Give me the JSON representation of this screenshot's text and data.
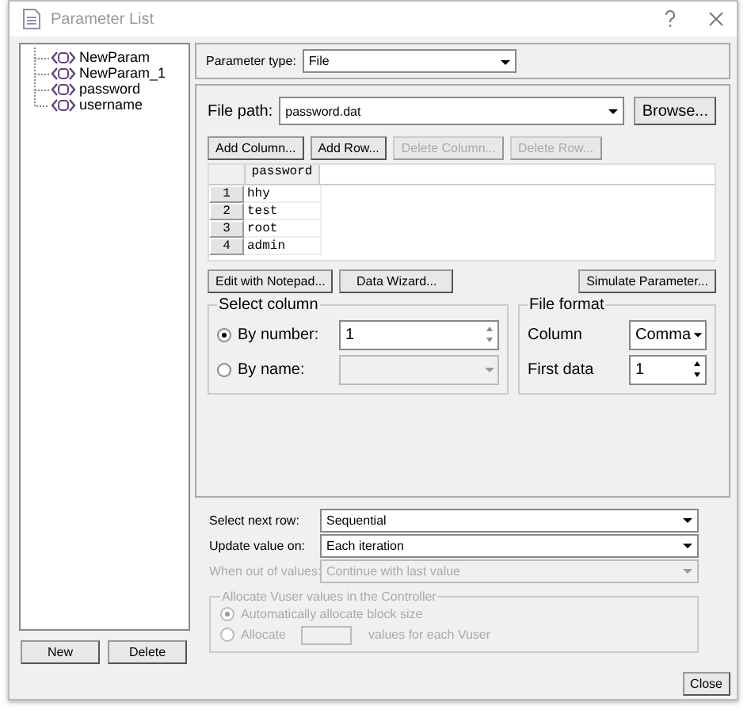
{
  "window": {
    "title": "Parameter List"
  },
  "parameters": [
    {
      "label": "NewParam",
      "selected": false
    },
    {
      "label": "NewParam_1",
      "selected": false
    },
    {
      "label": "password",
      "selected": false
    },
    {
      "label": "username",
      "selected": false
    }
  ],
  "parameter_type": {
    "label": "Parameter type:",
    "value": "File"
  },
  "file_path": {
    "label": "File path:",
    "value": "password.dat",
    "browse": "Browse..."
  },
  "grid_buttons": [
    {
      "label": "Add Column...",
      "disabled": false
    },
    {
      "label": "Add Row...",
      "disabled": false
    },
    {
      "label": "Delete Column...",
      "disabled": true
    },
    {
      "label": "Delete Row...",
      "disabled": true
    }
  ],
  "table": {
    "columns": [
      "password"
    ],
    "rows": [
      {
        "number": "1",
        "cells": [
          "hhy"
        ]
      },
      {
        "number": "2",
        "cells": [
          "test"
        ]
      },
      {
        "number": "3",
        "cells": [
          "root"
        ]
      },
      {
        "number": "4",
        "cells": [
          "admin"
        ]
      }
    ]
  },
  "action_buttons": [
    "Edit with Notepad...",
    "Data Wizard...",
    "Simulate Parameter..."
  ],
  "select_column": {
    "title": "Select column",
    "options": [
      {
        "label": "By number:",
        "selected": true,
        "kind": "spin",
        "value": "1",
        "disabled": false
      },
      {
        "label": "By name:",
        "selected": false,
        "kind": "dropdown",
        "disabled": true
      }
    ]
  },
  "file_format": {
    "title": "File format",
    "column": {
      "label": "Column",
      "value": "Comma"
    },
    "first_data": {
      "label": "First data",
      "value": "1"
    }
  },
  "settings": [
    {
      "label": "Select next row:",
      "value": "Sequential",
      "disabled": false
    },
    {
      "label": "Update value on:",
      "value": "Each iteration",
      "disabled": false
    },
    {
      "label": "When out of values:",
      "value": "Continue with last value",
      "disabled": true
    }
  ],
  "allocate": {
    "title": "Allocate Vuser values in the Controller",
    "disabled": true,
    "options": [
      {
        "label": "Automatically allocate block size",
        "selected": true
      },
      {
        "label": "Allocate",
        "selected": false,
        "suffix": "values for each Vuser"
      }
    ]
  },
  "footer": {
    "new": "New",
    "delete": "Delete",
    "close": "Close"
  }
}
